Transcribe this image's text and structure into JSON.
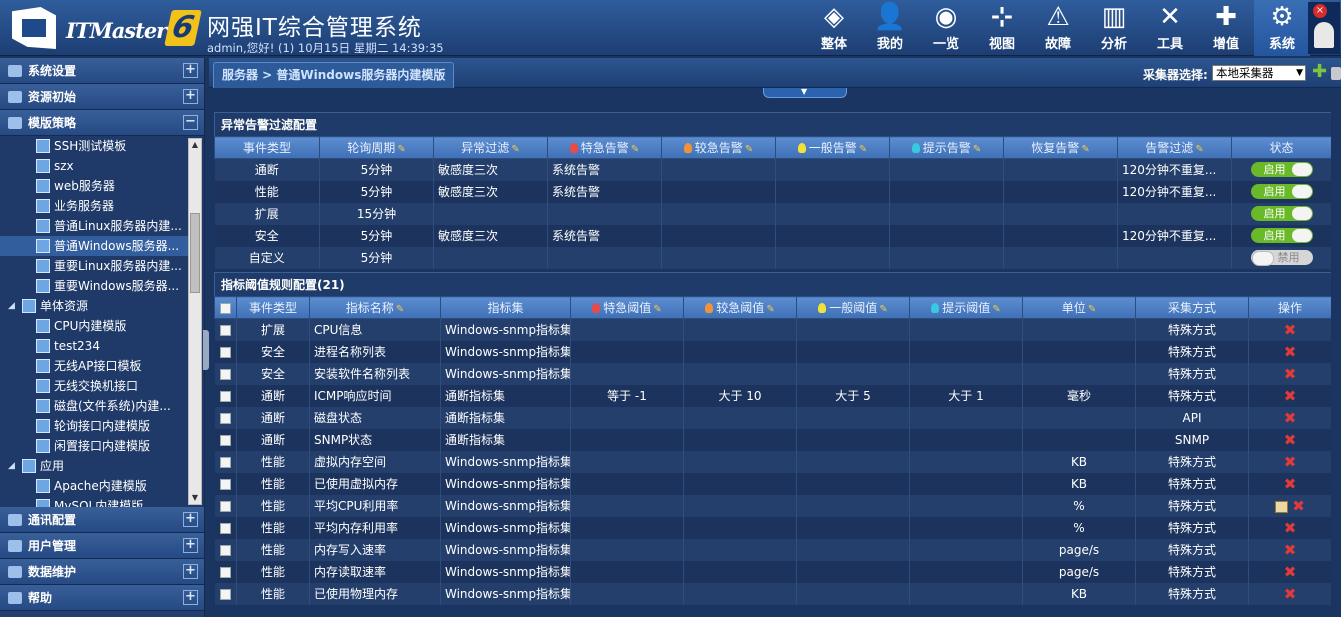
{
  "header": {
    "brand": "ITMaster",
    "version": "6",
    "title": "网强IT综合管理系统",
    "welcome": "admin,您好! (1) 10月15日 星期二 14:39:35",
    "nav": [
      {
        "label": "整体",
        "icon": "layers-icon",
        "glyph": "◈"
      },
      {
        "label": "我的",
        "icon": "user-icon",
        "glyph": "👤"
      },
      {
        "label": "一览",
        "icon": "aperture-icon",
        "glyph": "◉"
      },
      {
        "label": "视图",
        "icon": "network-icon",
        "glyph": "⊹"
      },
      {
        "label": "故障",
        "icon": "warning-icon",
        "glyph": "⚠"
      },
      {
        "label": "分析",
        "icon": "bar-chart-icon",
        "glyph": "▥"
      },
      {
        "label": "工具",
        "icon": "tools-icon",
        "glyph": "✕"
      },
      {
        "label": "增值",
        "icon": "plus-icon",
        "glyph": "✚"
      },
      {
        "label": "系统",
        "icon": "gear-icon",
        "glyph": "⚙"
      }
    ]
  },
  "sidebar": {
    "top_sections": [
      "系统设置",
      "资源初始",
      "模版策略"
    ],
    "tree": [
      {
        "label": "SSH测试模板",
        "indent": 2
      },
      {
        "label": "szx",
        "indent": 2
      },
      {
        "label": "web服务器",
        "indent": 2
      },
      {
        "label": "业务服务器",
        "indent": 2
      },
      {
        "label": "普通Linux服务器内建...",
        "indent": 2
      },
      {
        "label": "普通Windows服务器...",
        "indent": 2,
        "selected": true
      },
      {
        "label": "重要Linux服务器内建...",
        "indent": 2
      },
      {
        "label": "重要Windows服务器...",
        "indent": 2
      },
      {
        "label": "单体资源",
        "indent": 1,
        "group": true
      },
      {
        "label": "CPU内建模版",
        "indent": 2
      },
      {
        "label": "test234",
        "indent": 2
      },
      {
        "label": "无线AP接口模板",
        "indent": 2
      },
      {
        "label": "无线交换机接口",
        "indent": 2
      },
      {
        "label": "磁盘(文件系统)内建...",
        "indent": 2
      },
      {
        "label": "轮询接口内建模版",
        "indent": 2
      },
      {
        "label": "闲置接口内建模版",
        "indent": 2
      },
      {
        "label": "应用",
        "indent": 1,
        "group": true
      },
      {
        "label": "Apache内建模版",
        "indent": 2
      },
      {
        "label": "MySQL内建模版",
        "indent": 2
      }
    ],
    "bottom_sections": [
      "通讯配置",
      "用户管理",
      "数据维护",
      "帮助"
    ]
  },
  "main": {
    "breadcrumb": "服务器 > 普通Windows服务器内建模版",
    "collector_label": "采集器选择:",
    "collector_value": "本地采集器",
    "colors": {
      "critical": "#e84a4a",
      "major": "#f0923a",
      "minor": "#f2e13a",
      "hint": "#3ac7e0"
    },
    "alarm_filter": {
      "title": "异常告警过滤配置",
      "headers": [
        "事件类型",
        "轮询周期",
        "异常过滤",
        "特急告警",
        "较急告警",
        "一般告警",
        "提示告警",
        "恢复告警",
        "告警过滤",
        "状态"
      ],
      "rows": [
        {
          "type": "通断",
          "period": "5分钟",
          "filter": "敏感度三次",
          "critical": "系统告警",
          "agg": "120分钟不重复...",
          "status": "启用",
          "on": true
        },
        {
          "type": "性能",
          "period": "5分钟",
          "filter": "敏感度三次",
          "critical": "系统告警",
          "agg": "120分钟不重复...",
          "status": "启用",
          "on": true
        },
        {
          "type": "扩展",
          "period": "15分钟",
          "filter": "",
          "critical": "",
          "agg": "",
          "status": "启用",
          "on": true
        },
        {
          "type": "安全",
          "period": "5分钟",
          "filter": "敏感度三次",
          "critical": "系统告警",
          "agg": "120分钟不重复...",
          "status": "启用",
          "on": true
        },
        {
          "type": "自定义",
          "period": "5分钟",
          "filter": "",
          "critical": "",
          "agg": "",
          "status": "禁用",
          "on": false
        }
      ]
    },
    "threshold": {
      "title": "指标阈值规则配置(21)",
      "headers": [
        "事件类型",
        "指标名称",
        "指标集",
        "特急阈值",
        "较急阈值",
        "一般阈值",
        "提示阈值",
        "单位",
        "采集方式",
        "操作"
      ],
      "rows": [
        {
          "type": "扩展",
          "name": "CPU信息",
          "set": "Windows-snmp指标集",
          "c": "",
          "m": "",
          "n": "",
          "h": "",
          "unit": "",
          "method": "特殊方式",
          "edit": false
        },
        {
          "type": "安全",
          "name": "进程名称列表",
          "set": "Windows-snmp指标集",
          "c": "",
          "m": "",
          "n": "",
          "h": "",
          "unit": "",
          "method": "特殊方式",
          "edit": false
        },
        {
          "type": "安全",
          "name": "安装软件名称列表",
          "set": "Windows-snmp指标集",
          "c": "",
          "m": "",
          "n": "",
          "h": "",
          "unit": "",
          "method": "特殊方式",
          "edit": false
        },
        {
          "type": "通断",
          "name": "ICMP响应时间",
          "set": "通断指标集",
          "c": "等于 -1",
          "m": "大于 10",
          "n": "大于 5",
          "h": "大于 1",
          "unit": "毫秒",
          "method": "特殊方式",
          "edit": false
        },
        {
          "type": "通断",
          "name": "磁盘状态",
          "set": "通断指标集",
          "c": "",
          "m": "",
          "n": "",
          "h": "",
          "unit": "",
          "method": "API",
          "edit": false
        },
        {
          "type": "通断",
          "name": "SNMP状态",
          "set": "通断指标集",
          "c": "",
          "m": "",
          "n": "",
          "h": "",
          "unit": "",
          "method": "SNMP",
          "edit": false
        },
        {
          "type": "性能",
          "name": "虚拟内存空间",
          "set": "Windows-snmp指标集",
          "c": "",
          "m": "",
          "n": "",
          "h": "",
          "unit": "KB",
          "method": "特殊方式",
          "edit": false
        },
        {
          "type": "性能",
          "name": "已使用虚拟内存",
          "set": "Windows-snmp指标集",
          "c": "",
          "m": "",
          "n": "",
          "h": "",
          "unit": "KB",
          "method": "特殊方式",
          "edit": false
        },
        {
          "type": "性能",
          "name": "平均CPU利用率",
          "set": "Windows-snmp指标集",
          "c": "",
          "m": "",
          "n": "",
          "h": "",
          "unit": "%",
          "method": "特殊方式",
          "edit": true
        },
        {
          "type": "性能",
          "name": "平均内存利用率",
          "set": "Windows-snmp指标集",
          "c": "",
          "m": "",
          "n": "",
          "h": "",
          "unit": "%",
          "method": "特殊方式",
          "edit": false
        },
        {
          "type": "性能",
          "name": "内存写入速率",
          "set": "Windows-snmp指标集",
          "c": "",
          "m": "",
          "n": "",
          "h": "",
          "unit": "page/s",
          "method": "特殊方式",
          "edit": false
        },
        {
          "type": "性能",
          "name": "内存读取速率",
          "set": "Windows-snmp指标集",
          "c": "",
          "m": "",
          "n": "",
          "h": "",
          "unit": "page/s",
          "method": "特殊方式",
          "edit": false
        },
        {
          "type": "性能",
          "name": "已使用物理内存",
          "set": "Windows-snmp指标集",
          "c": "",
          "m": "",
          "n": "",
          "h": "",
          "unit": "KB",
          "method": "特殊方式",
          "edit": false
        }
      ]
    }
  }
}
